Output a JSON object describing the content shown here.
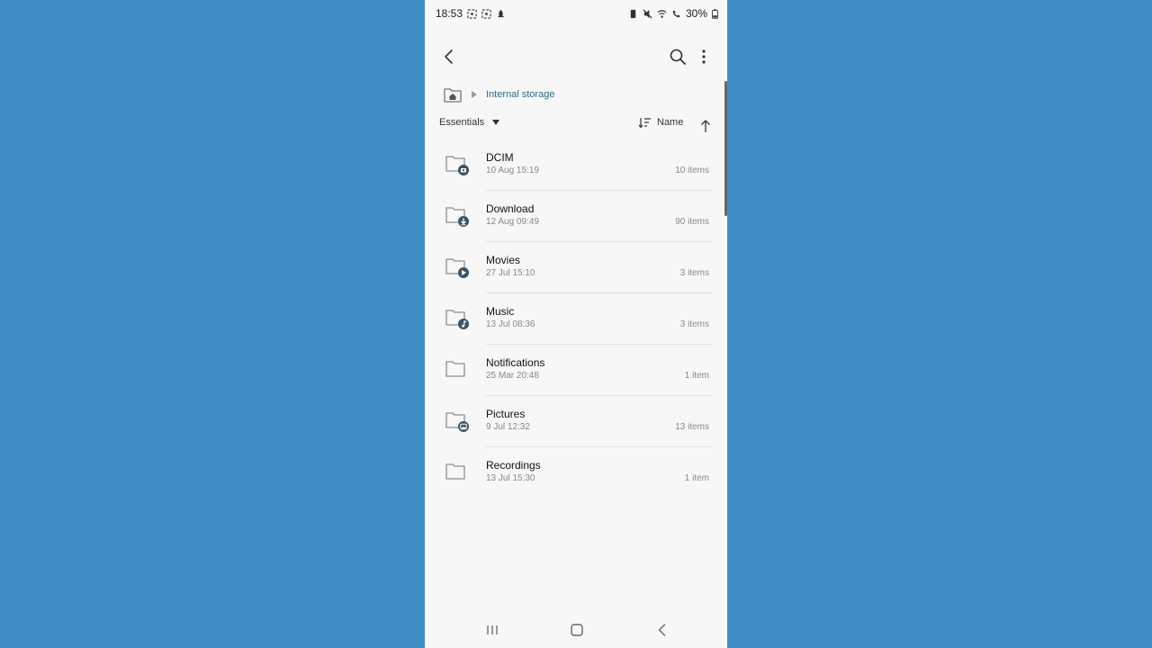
{
  "status_bar": {
    "time": "18:53",
    "battery": "30%",
    "icons": [
      "screenshot-icon",
      "screenshot-icon",
      "notification-icon",
      "battery-saver-icon",
      "mute-icon",
      "wifi-icon",
      "wifi-call-icon",
      "battery-icon"
    ]
  },
  "breadcrumb": {
    "location": "Internal storage"
  },
  "sort_bar": {
    "filter_label": "Essentials",
    "sort_label": "Name"
  },
  "folders": [
    {
      "name": "DCIM",
      "date": "10 Aug 15:19",
      "count": "10 items",
      "badge": "camera"
    },
    {
      "name": "Download",
      "date": "12 Aug 09:49",
      "count": "90 items",
      "badge": "download"
    },
    {
      "name": "Movies",
      "date": "27 Jul 15:10",
      "count": "3 items",
      "badge": "play"
    },
    {
      "name": "Music",
      "date": "13 Jul 08:36",
      "count": "3 items",
      "badge": "music"
    },
    {
      "name": "Notifications",
      "date": "25 Mar 20:48",
      "count": "1 item",
      "badge": "none"
    },
    {
      "name": "Pictures",
      "date": "9 Jul 12:32",
      "count": "13 items",
      "badge": "image"
    },
    {
      "name": "Recordings",
      "date": "13 Jul 15:30",
      "count": "1 item",
      "badge": "none"
    }
  ],
  "colors": {
    "background": "#3f8ec6",
    "screen": "#f7f7f7",
    "accent": "#2f6e86",
    "badge": "#3d5364"
  }
}
